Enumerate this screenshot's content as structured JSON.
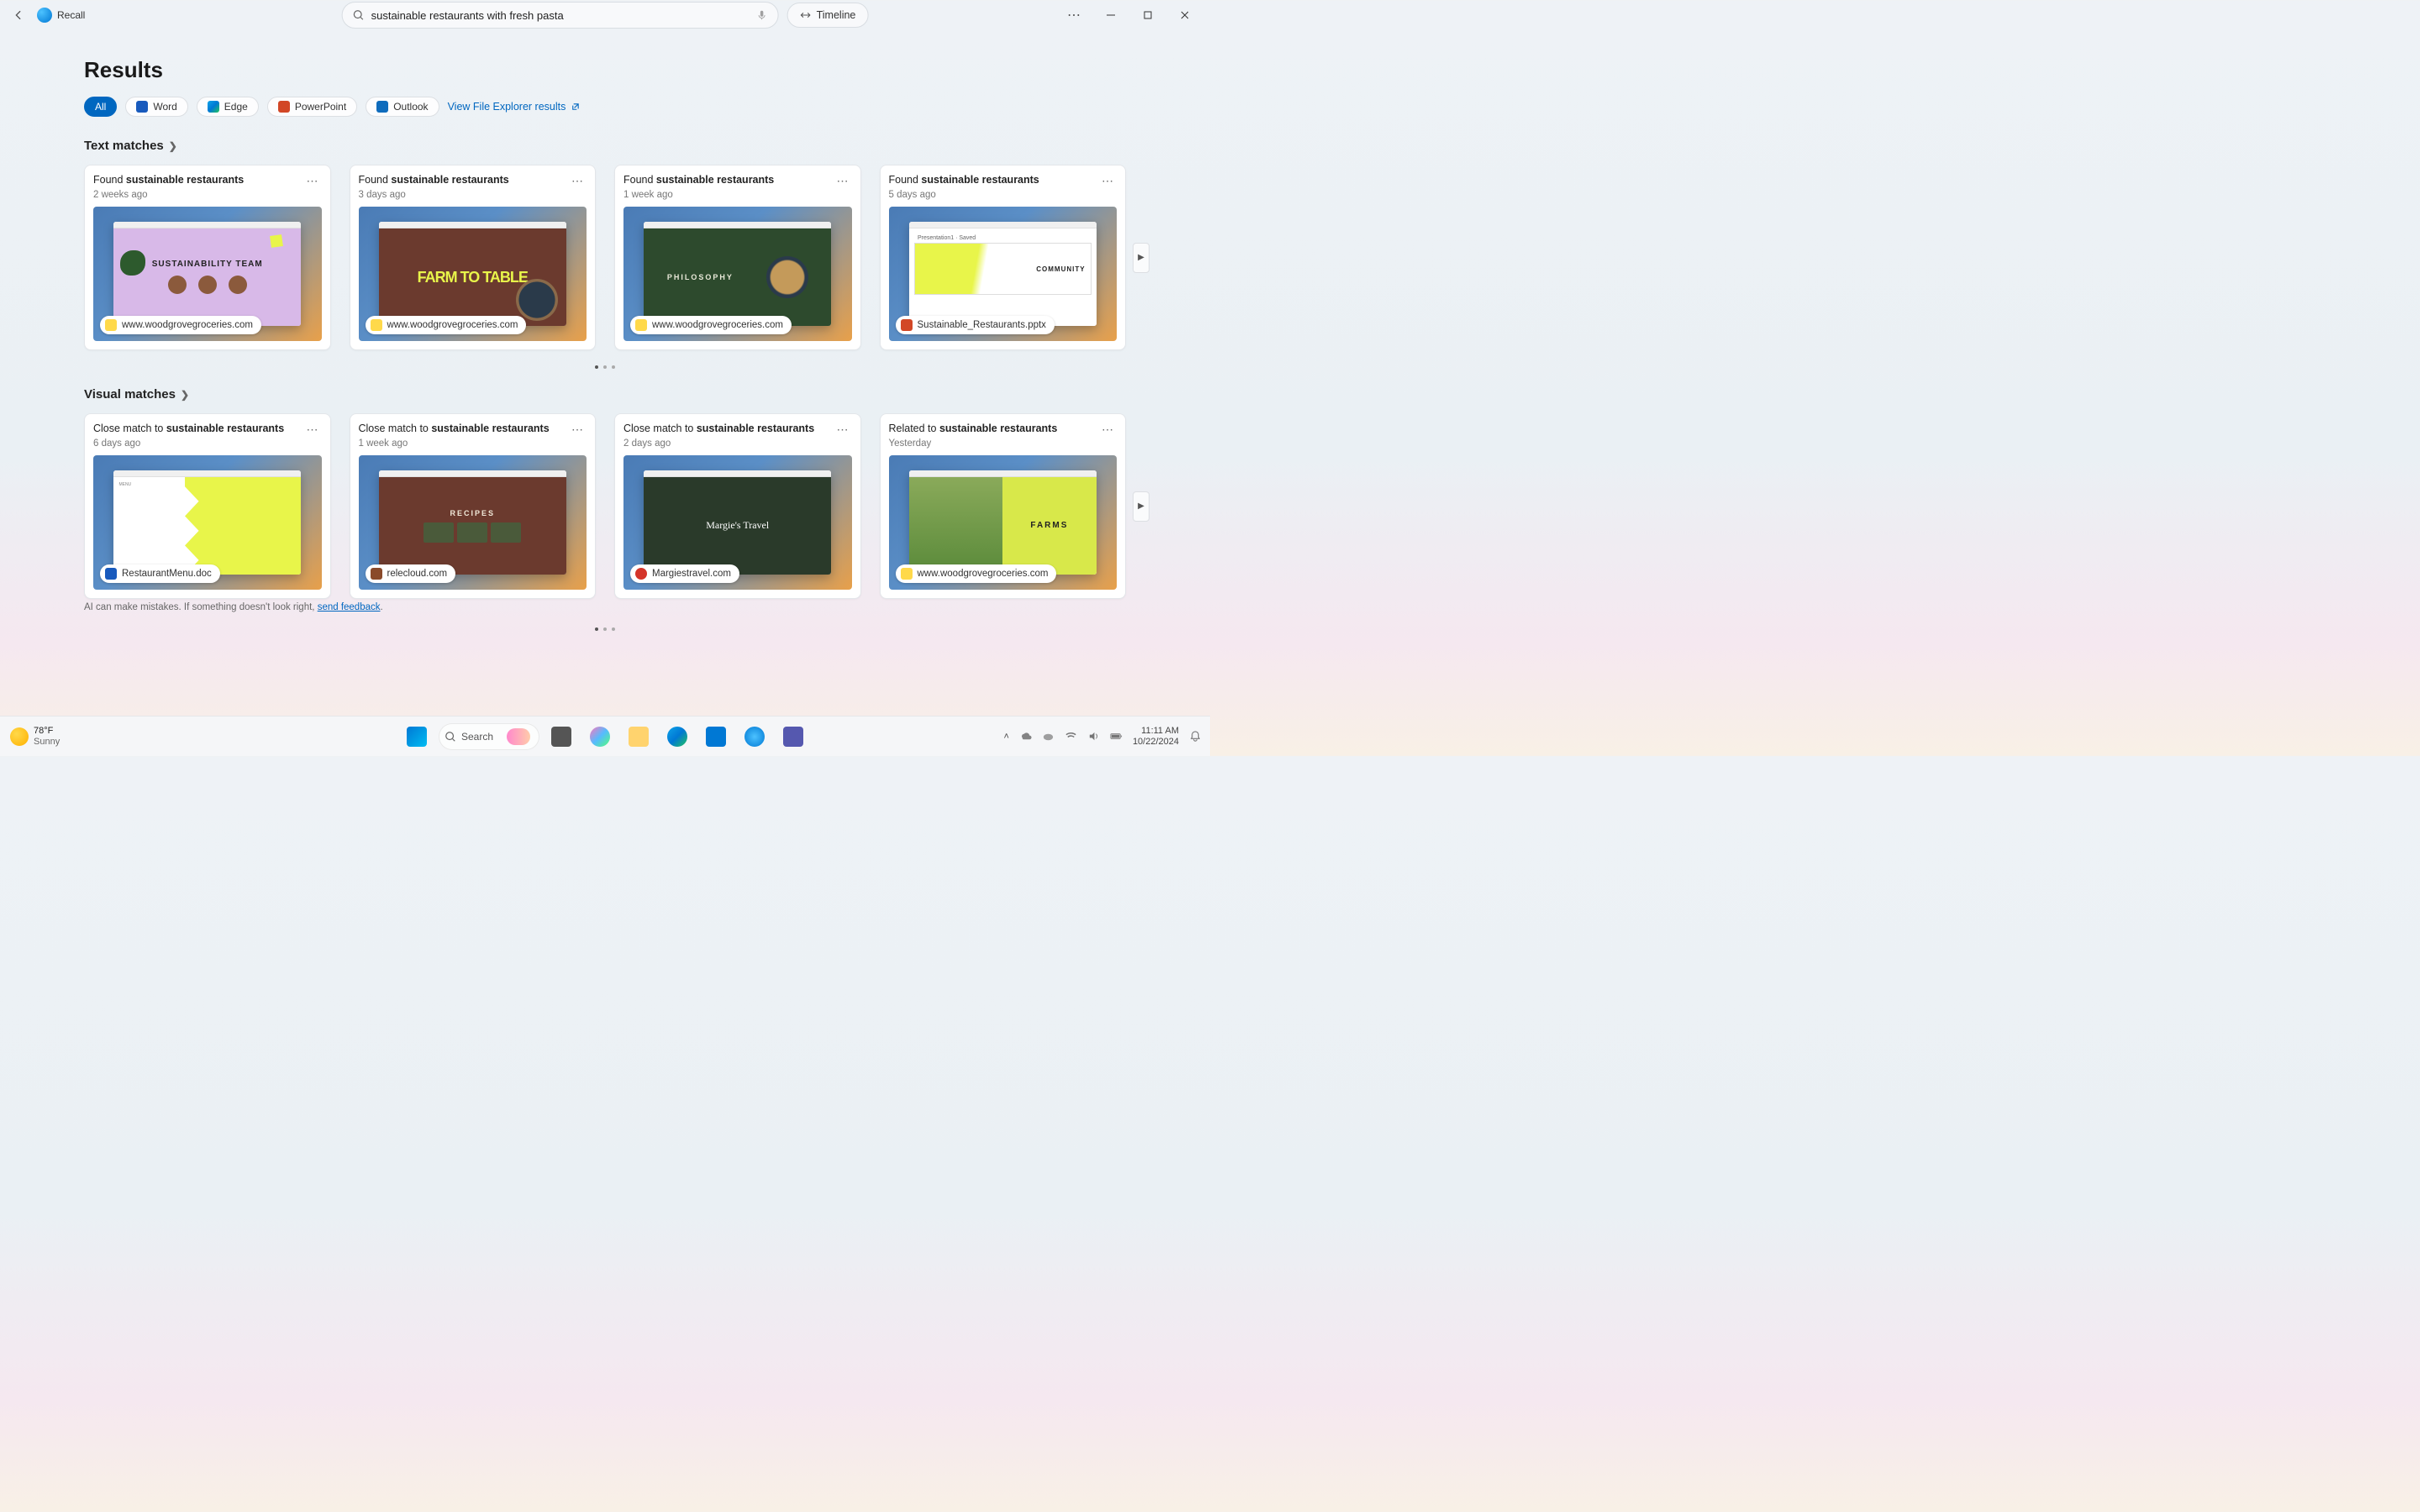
{
  "app": {
    "name": "Recall"
  },
  "search": {
    "query": "sustainable restaurants with fresh pasta",
    "placeholder": "Search"
  },
  "timeline_label": "Timeline",
  "results_heading": "Results",
  "filters": {
    "all": "All",
    "word": "Word",
    "edge": "Edge",
    "powerpoint": "PowerPoint",
    "outlook": "Outlook",
    "view_explorer": "View File Explorer results"
  },
  "sections": {
    "text_matches": "Text matches",
    "visual_matches": "Visual matches"
  },
  "text_cards": [
    {
      "prefix": "Found ",
      "match": "sustainable restaurants",
      "time": "2 weeks ago",
      "source": "www.woodgrovegroceries.com",
      "thumb_title": "SUSTAINABILITY TEAM",
      "source_type": "web"
    },
    {
      "prefix": "Found ",
      "match": "sustainable restaurants",
      "time": "3 days ago",
      "source": "www.woodgrovegroceries.com",
      "thumb_title": "FARM TO TABLE",
      "source_type": "web"
    },
    {
      "prefix": "Found ",
      "match": "sustainable restaurants",
      "time": "1 week ago",
      "source": "www.woodgrovegroceries.com",
      "thumb_title": "PHILOSOPHY",
      "source_type": "web"
    },
    {
      "prefix": "Found ",
      "match": "sustainable restaurants",
      "time": "5 days ago",
      "source": "Sustainable_Restaurants.pptx",
      "thumb_title": "COMMUNITY",
      "thumb_sub": "Presentation1 · Saved",
      "source_type": "ppt"
    }
  ],
  "visual_cards": [
    {
      "prefix": "Close match to ",
      "match": "sustainable restaurants",
      "time": "6 days ago",
      "source": "RestaurantMenu.doc",
      "thumb_title": "MENU",
      "source_type": "word"
    },
    {
      "prefix": "Close match to ",
      "match": "sustainable restaurants",
      "time": "1 week ago",
      "source": "relecloud.com",
      "thumb_title": "RECIPES",
      "source_type": "web-alt"
    },
    {
      "prefix": "Close match to ",
      "match": "sustainable restaurants",
      "time": "2 days ago",
      "source": "Margiestravel.com",
      "thumb_title": "Margie's Travel",
      "source_type": "web-red"
    },
    {
      "prefix": "Related to ",
      "match": "sustainable restaurants",
      "time": "Yesterday",
      "source": "www.woodgrovegroceries.com",
      "thumb_title": "FARMS",
      "source_type": "web"
    }
  ],
  "disclaimer": {
    "text_before": "AI can make mistakes. If something doesn't look right, ",
    "link": "send feedback",
    "text_after": "."
  },
  "taskbar": {
    "weather_temp": "78°F",
    "weather_cond": "Sunny",
    "search_label": "Search",
    "time": "11:11 AM",
    "date": "10/22/2024"
  }
}
